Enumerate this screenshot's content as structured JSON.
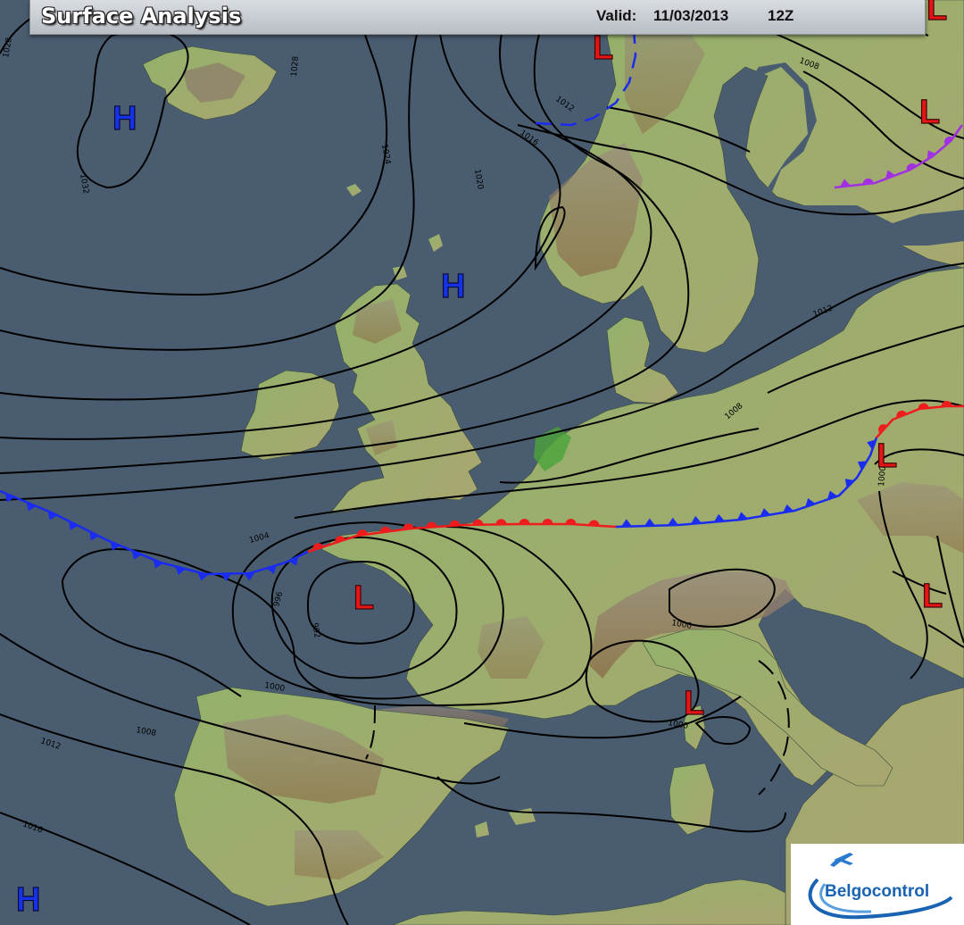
{
  "header": {
    "title": "Surface Analysis",
    "valid_label": "Valid:",
    "valid_date": "11/03/2013",
    "valid_time": "12Z"
  },
  "logo": {
    "text": "Belgocontrol",
    "icon": "airplane-icon"
  },
  "colors": {
    "sea": "#4a5d70",
    "land_low": "#8fae6a",
    "land_high": "#9a7a55",
    "high_pressure": "#1432e6",
    "low_pressure": "#e61414",
    "cold_front": "#1a2cf0",
    "warm_front": "#ee1c1c",
    "occluded_front": "#a030e0",
    "isobar": "#000000"
  },
  "pressure_systems": [
    {
      "type": "H",
      "label": "H",
      "location": "south of Iceland"
    },
    {
      "type": "H",
      "label": "H",
      "location": "north of Scotland"
    },
    {
      "type": "H",
      "label": "H",
      "location": "off Portugal"
    },
    {
      "type": "L",
      "label": "L",
      "location": "Norwegian coast"
    },
    {
      "type": "L",
      "label": "L",
      "location": "Finland"
    },
    {
      "type": "L",
      "label": "L",
      "location": "Brittany"
    },
    {
      "type": "L",
      "label": "L",
      "location": "Czech Republic"
    },
    {
      "type": "L",
      "label": "L",
      "location": "Hungary"
    },
    {
      "type": "L",
      "label": "L",
      "location": "Corsica / Ligurian Sea"
    },
    {
      "type": "L",
      "label": "L",
      "location": "top right corner"
    }
  ],
  "isobar_labels": [
    "1028",
    "1032",
    "1028",
    "1024",
    "1020",
    "1016",
    "1012",
    "1004",
    "1008",
    "1012",
    "1008",
    "1004",
    "996",
    "992",
    "1000",
    "1008",
    "1012",
    "1016",
    "1000",
    "1000",
    "1000"
  ],
  "fronts": [
    {
      "type": "cold",
      "location": "Atlantic to Brittany"
    },
    {
      "type": "warm",
      "location": "Brittany to Alps"
    },
    {
      "type": "cold",
      "location": "Alps to Czech Republic"
    },
    {
      "type": "warm",
      "location": "Czech Republic"
    },
    {
      "type": "cold",
      "location": "Norwegian coast (dashed)"
    },
    {
      "type": "occluded",
      "location": "Finland"
    }
  ]
}
